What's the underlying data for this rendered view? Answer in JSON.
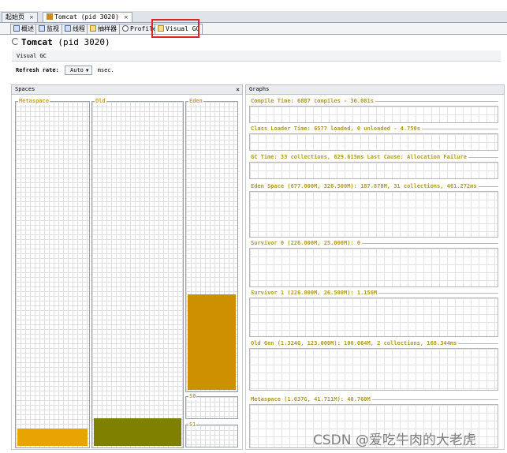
{
  "doc_tabs": [
    {
      "label": "起始页",
      "close": "×"
    },
    {
      "label": "Tomcat (pid 3020)",
      "close": "×"
    }
  ],
  "view_tabs": [
    {
      "label": "概述",
      "icon": "overview-icon"
    },
    {
      "label": "监视",
      "icon": "monitor-icon"
    },
    {
      "label": "线程",
      "icon": "threads-icon"
    },
    {
      "label": "抽样器",
      "icon": "sampler-icon"
    },
    {
      "label": "Profiler",
      "icon": "profiler-icon"
    },
    {
      "label": "Visual GC",
      "icon": "visualgc-icon",
      "active": true
    }
  ],
  "app": {
    "title_bold": "Tomcat",
    "title_rest": " (pid 3020)"
  },
  "section": {
    "label": "Visual GC"
  },
  "refresh": {
    "label": "Refresh rate:",
    "value": "Auto",
    "unit": "msec."
  },
  "spaces_panel": {
    "title": "Spaces",
    "close": "×",
    "spaces": [
      {
        "name": "Metaspace",
        "fill_fraction": 0.05,
        "color": "#e8a400"
      },
      {
        "name": "Old",
        "fill_fraction": 0.08,
        "color": "#808000"
      },
      {
        "name": "Eden",
        "fill_fraction": 0.33,
        "color": "#cc9000"
      },
      {
        "name": "S0",
        "fill_fraction": 0.0,
        "color": "#cc9000"
      },
      {
        "name": "S1",
        "fill_fraction": 0.0,
        "color": "#cc9000"
      }
    ]
  },
  "graphs_panel": {
    "title": "Graphs",
    "graphs": [
      {
        "title": "Compile Time: 6887 compiles - 30.081s"
      },
      {
        "title": "Class Loader Time: 6577 loaded, 0 unloaded - 4.750s"
      },
      {
        "title": "GC Time: 33 collections, 629.615ms Last Cause: Allocation Failure"
      },
      {
        "title": "Eden Space (677.000M, 326.500M): 187.878M, 31 collections, 461.272ms"
      },
      {
        "title": "Survivor 0 (226.000M, 25.000M): 0"
      },
      {
        "title": "Survivor 1 (226.000M, 26.500M): 1.156M"
      },
      {
        "title": "Old Gen (1.324G, 123.000M): 100.064M, 2 collections, 168.344ms"
      },
      {
        "title": "Metaspace (1.037G, 41.711M): 40.760M"
      }
    ]
  },
  "watermark": "CSDN @爱吃牛肉的大老虎",
  "colors": {
    "accent_red": "#e02424",
    "graph_title": "#b19a22",
    "space_label": "#c9a227"
  }
}
